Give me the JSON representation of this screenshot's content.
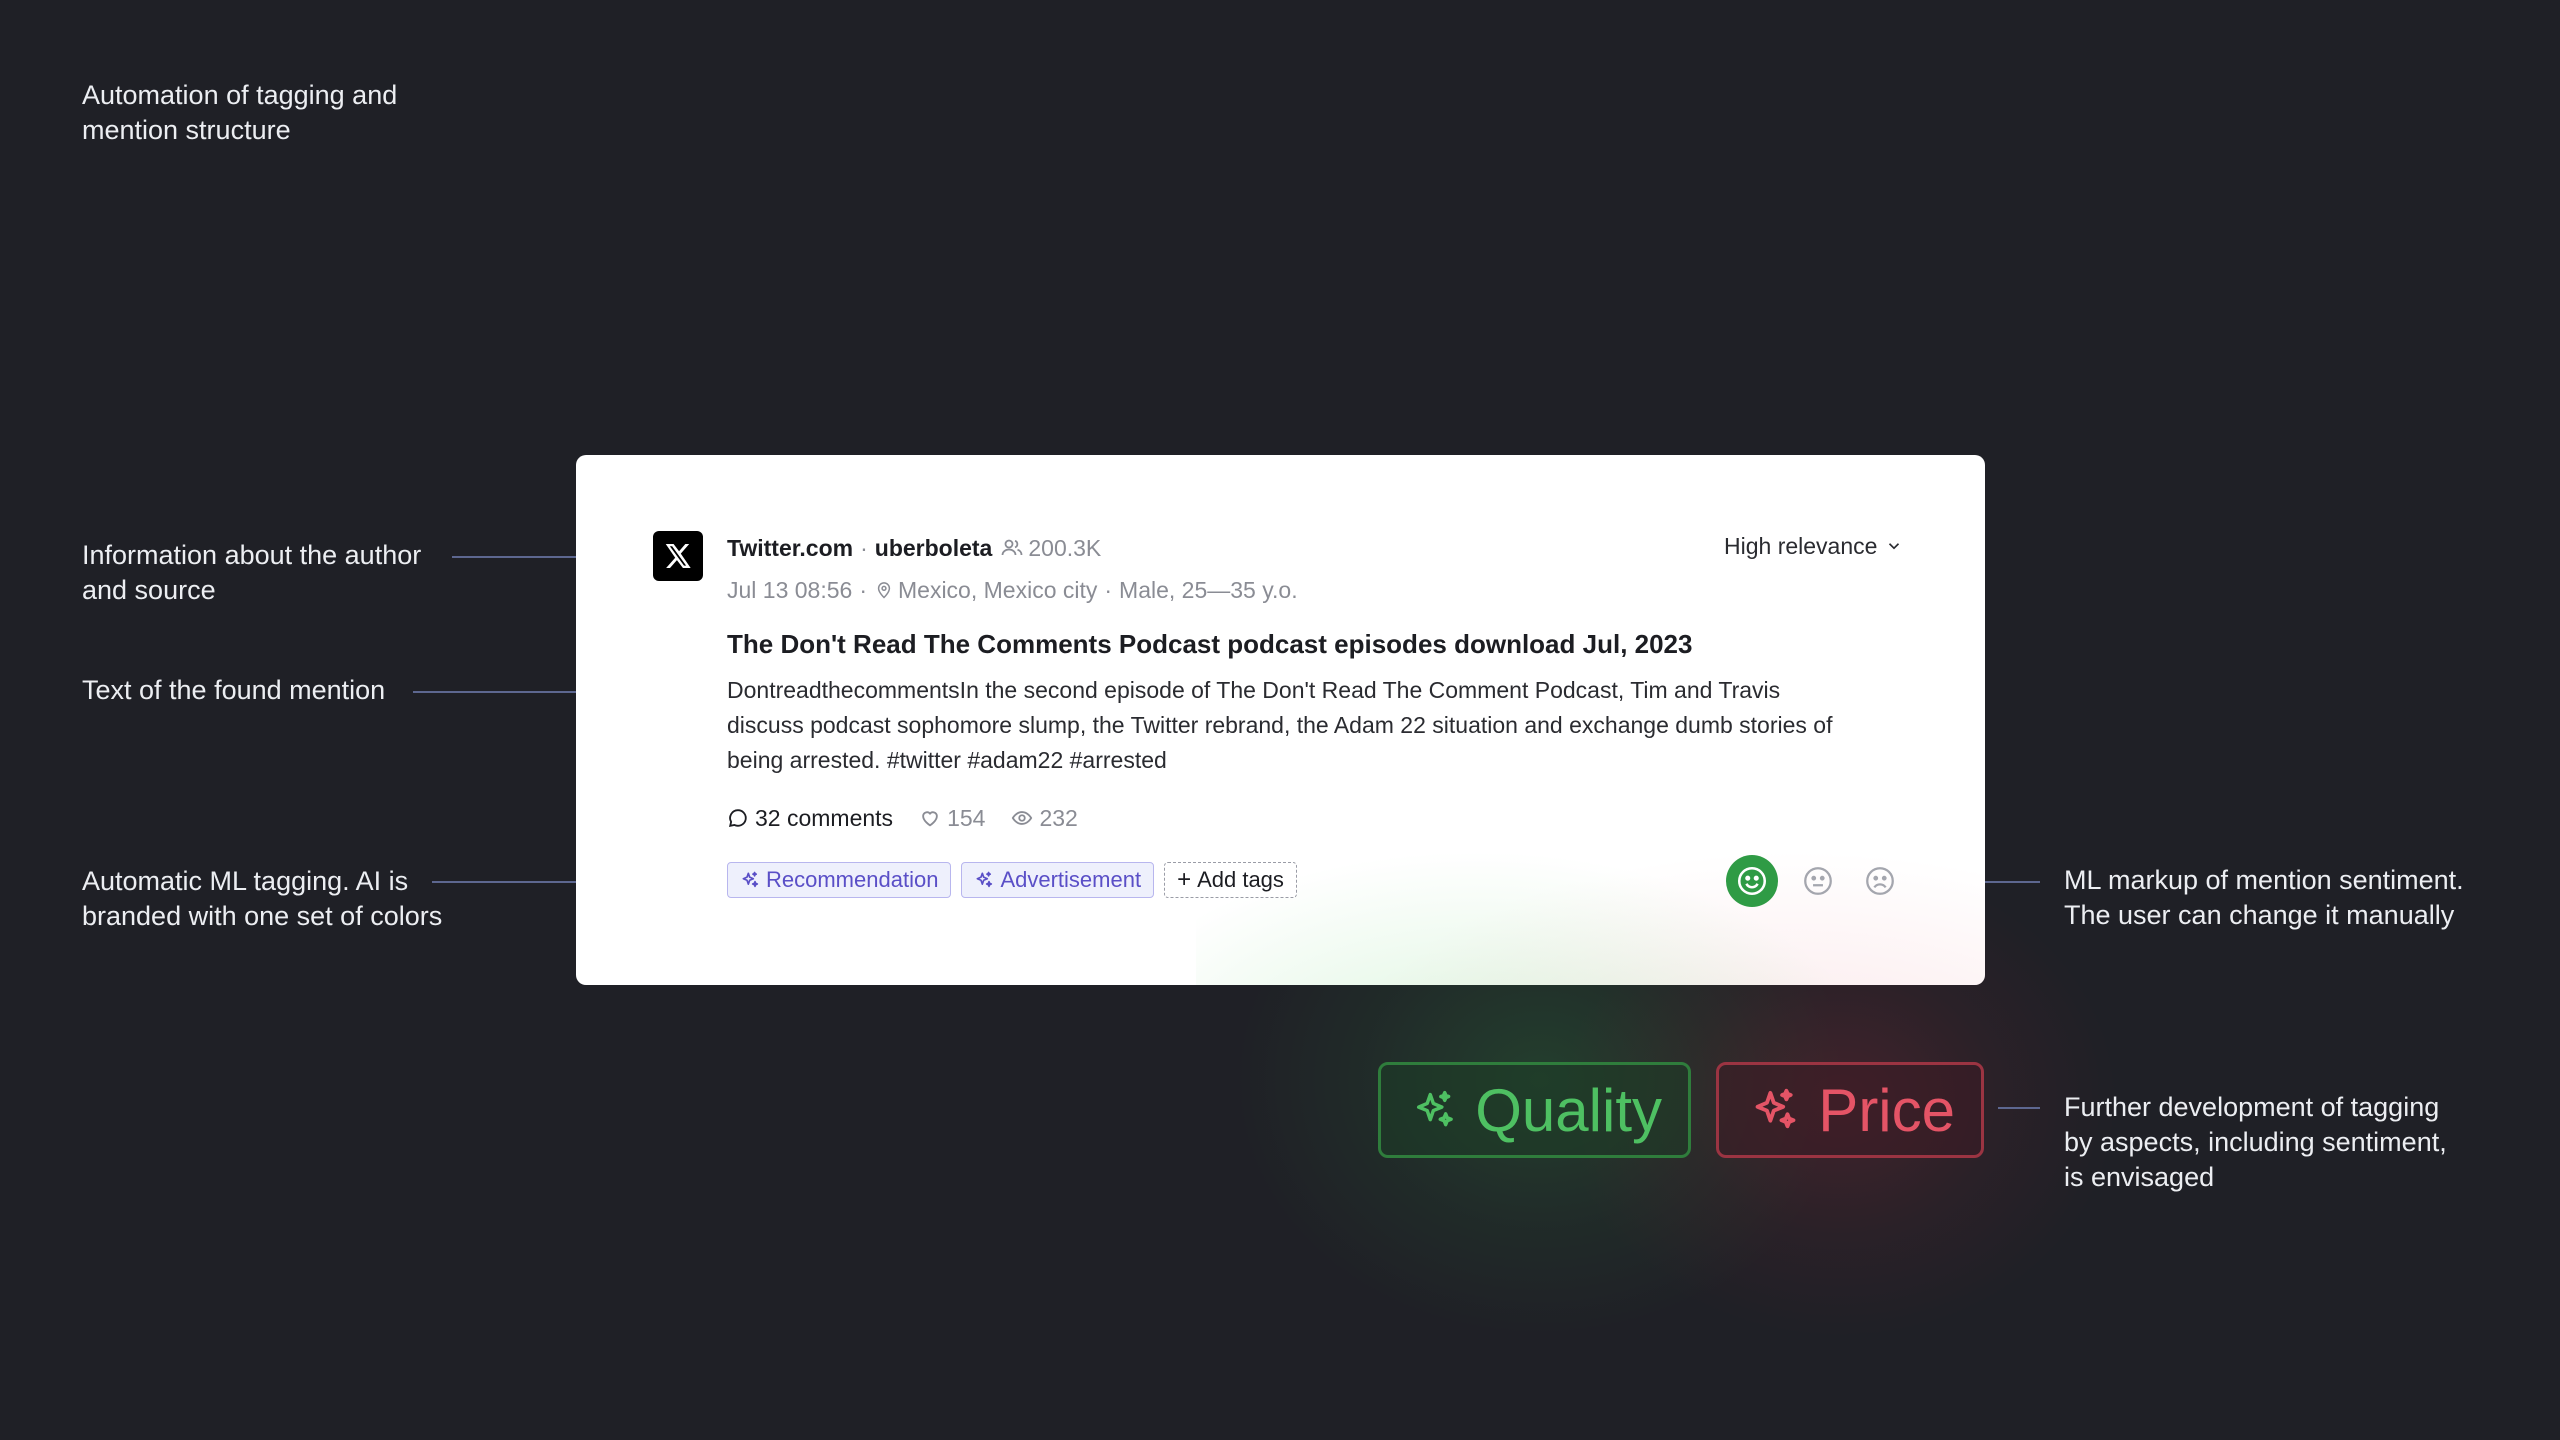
{
  "annotations": {
    "heading": "Automation of tagging and\nmention structure",
    "author_source": "Information about the author\nand source",
    "mention_text": "Text of the found mention",
    "ml_tagging": "Automatic ML tagging. AI is\nbranded with one set of colors",
    "sentiment": "ML markup of mention sentiment.\nThe user can change it manually",
    "aspects": "Further development of tagging\nby aspects, including sentiment,\nis envisaged"
  },
  "mention": {
    "source_icon": "x-logo-icon",
    "source": "Twitter.com",
    "separator": "·",
    "author": "uberboleta",
    "followers": "200.3K",
    "date": "Jul 13 08:56",
    "location": "Mexico, Mexico city",
    "demographics": "Male, 25—35 y.o.",
    "relevance": "High relevance",
    "title": "The Don't Read The Comments Podcast podcast episodes download Jul, 2023",
    "body": "DontreadthecommentsIn the second episode of The Don't Read The Comment Podcast, Tim and Travis discuss podcast sophomore slump, the Twitter rebrand, the Adam 22 situation and exchange dumb stories of being arrested. #twitter #adam22 #arrested",
    "stats": {
      "comments": "32 comments",
      "likes": "154",
      "views": "232"
    },
    "tags": [
      "Recommendation",
      "Advertisement"
    ],
    "add_tags": "Add tags",
    "sentiment_selected": "positive"
  },
  "aspect_tags": {
    "quality": "Quality",
    "price": "Price"
  },
  "colors": {
    "background": "#1f2026",
    "ai_tag": "#5a4fc7",
    "positive": "#2f9b45",
    "aspect_positive": "#4ec062",
    "aspect_negative": "#e45466"
  }
}
